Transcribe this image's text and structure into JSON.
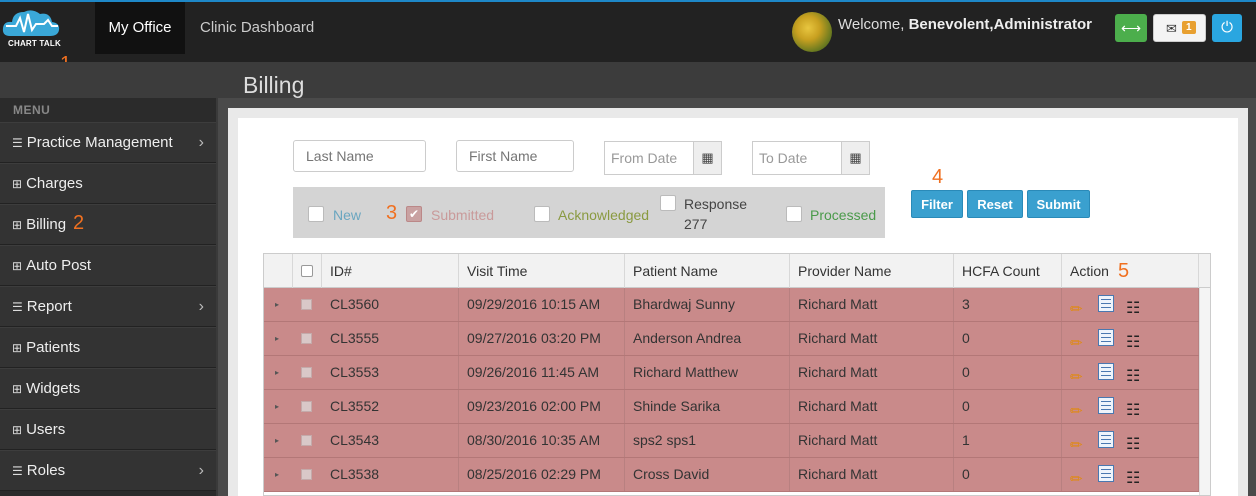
{
  "app": {
    "logo_text": "CHART TALK",
    "tabs": [
      {
        "label": "My Office"
      },
      {
        "label": "Clinic Dashboard"
      }
    ],
    "welcome_prefix": "Welcome, ",
    "user_name": "Benevolent,Administrator",
    "mail_count": "1"
  },
  "annotations": [
    "1",
    "2",
    "3",
    "4",
    "5"
  ],
  "page": {
    "title": "Billing"
  },
  "sidebar": {
    "menu_label": "MENU",
    "items": [
      {
        "label": "Practice Management",
        "icon": "list-icon",
        "has_submenu": true
      },
      {
        "label": "Charges",
        "icon": "grid-icon",
        "has_submenu": false
      },
      {
        "label": "Billing",
        "icon": "grid-icon",
        "has_submenu": false
      },
      {
        "label": "Auto Post",
        "icon": "grid-icon",
        "has_submenu": false
      },
      {
        "label": "Report",
        "icon": "list-icon",
        "has_submenu": true
      },
      {
        "label": "Patients",
        "icon": "grid-icon",
        "has_submenu": false
      },
      {
        "label": "Widgets",
        "icon": "grid-icon",
        "has_submenu": false
      },
      {
        "label": "Users",
        "icon": "grid-icon",
        "has_submenu": false
      },
      {
        "label": "Roles",
        "icon": "list-icon",
        "has_submenu": true
      }
    ]
  },
  "filters": {
    "last_name_placeholder": "Last Name",
    "first_name_placeholder": "First Name",
    "from_date_placeholder": "From Date",
    "to_date_placeholder": "To Date",
    "statuses": [
      {
        "label": "New",
        "checked": false,
        "color": "#6aa6c0"
      },
      {
        "label": "Submitted",
        "checked": true,
        "color": "#c99a9a"
      },
      {
        "label": "Acknowledged",
        "checked": false,
        "color": "#8a9a40"
      },
      {
        "label_line1": "Response",
        "label_line2": "277",
        "checked": false,
        "color": "#444444"
      },
      {
        "label": "Processed",
        "checked": false,
        "color": "#4a9a4a"
      }
    ],
    "buttons": {
      "filter": "Filter",
      "reset": "Reset",
      "submit": "Submit"
    }
  },
  "grid": {
    "columns": [
      "ID#",
      "Visit Time",
      "Patient Name",
      "Provider Name",
      "HCFA Count",
      "Action"
    ],
    "rows": [
      {
        "id": "CL3560",
        "visit_time": "09/29/2016 10:15 AM",
        "patient": "Bhardwaj Sunny",
        "provider": "Richard Matt",
        "hcfa": "3"
      },
      {
        "id": "CL3555",
        "visit_time": "09/27/2016 03:20 PM",
        "patient": "Anderson Andrea",
        "provider": "Richard Matt",
        "hcfa": "0"
      },
      {
        "id": "CL3553",
        "visit_time": "09/26/2016 11:45 AM",
        "patient": "Richard Matthew",
        "provider": "Richard Matt",
        "hcfa": "0"
      },
      {
        "id": "CL3552",
        "visit_time": "09/23/2016 02:00 PM",
        "patient": "Shinde Sarika",
        "provider": "Richard Matt",
        "hcfa": "0"
      },
      {
        "id": "CL3543",
        "visit_time": "08/30/2016 10:35 AM",
        "patient": "sps2 sps1",
        "provider": "Richard Matt",
        "hcfa": "1"
      },
      {
        "id": "CL3538",
        "visit_time": "08/25/2016 02:29 PM",
        "patient": "Cross David",
        "provider": "Richard Matt",
        "hcfa": "0"
      }
    ],
    "row_color": "#c98a8a"
  }
}
